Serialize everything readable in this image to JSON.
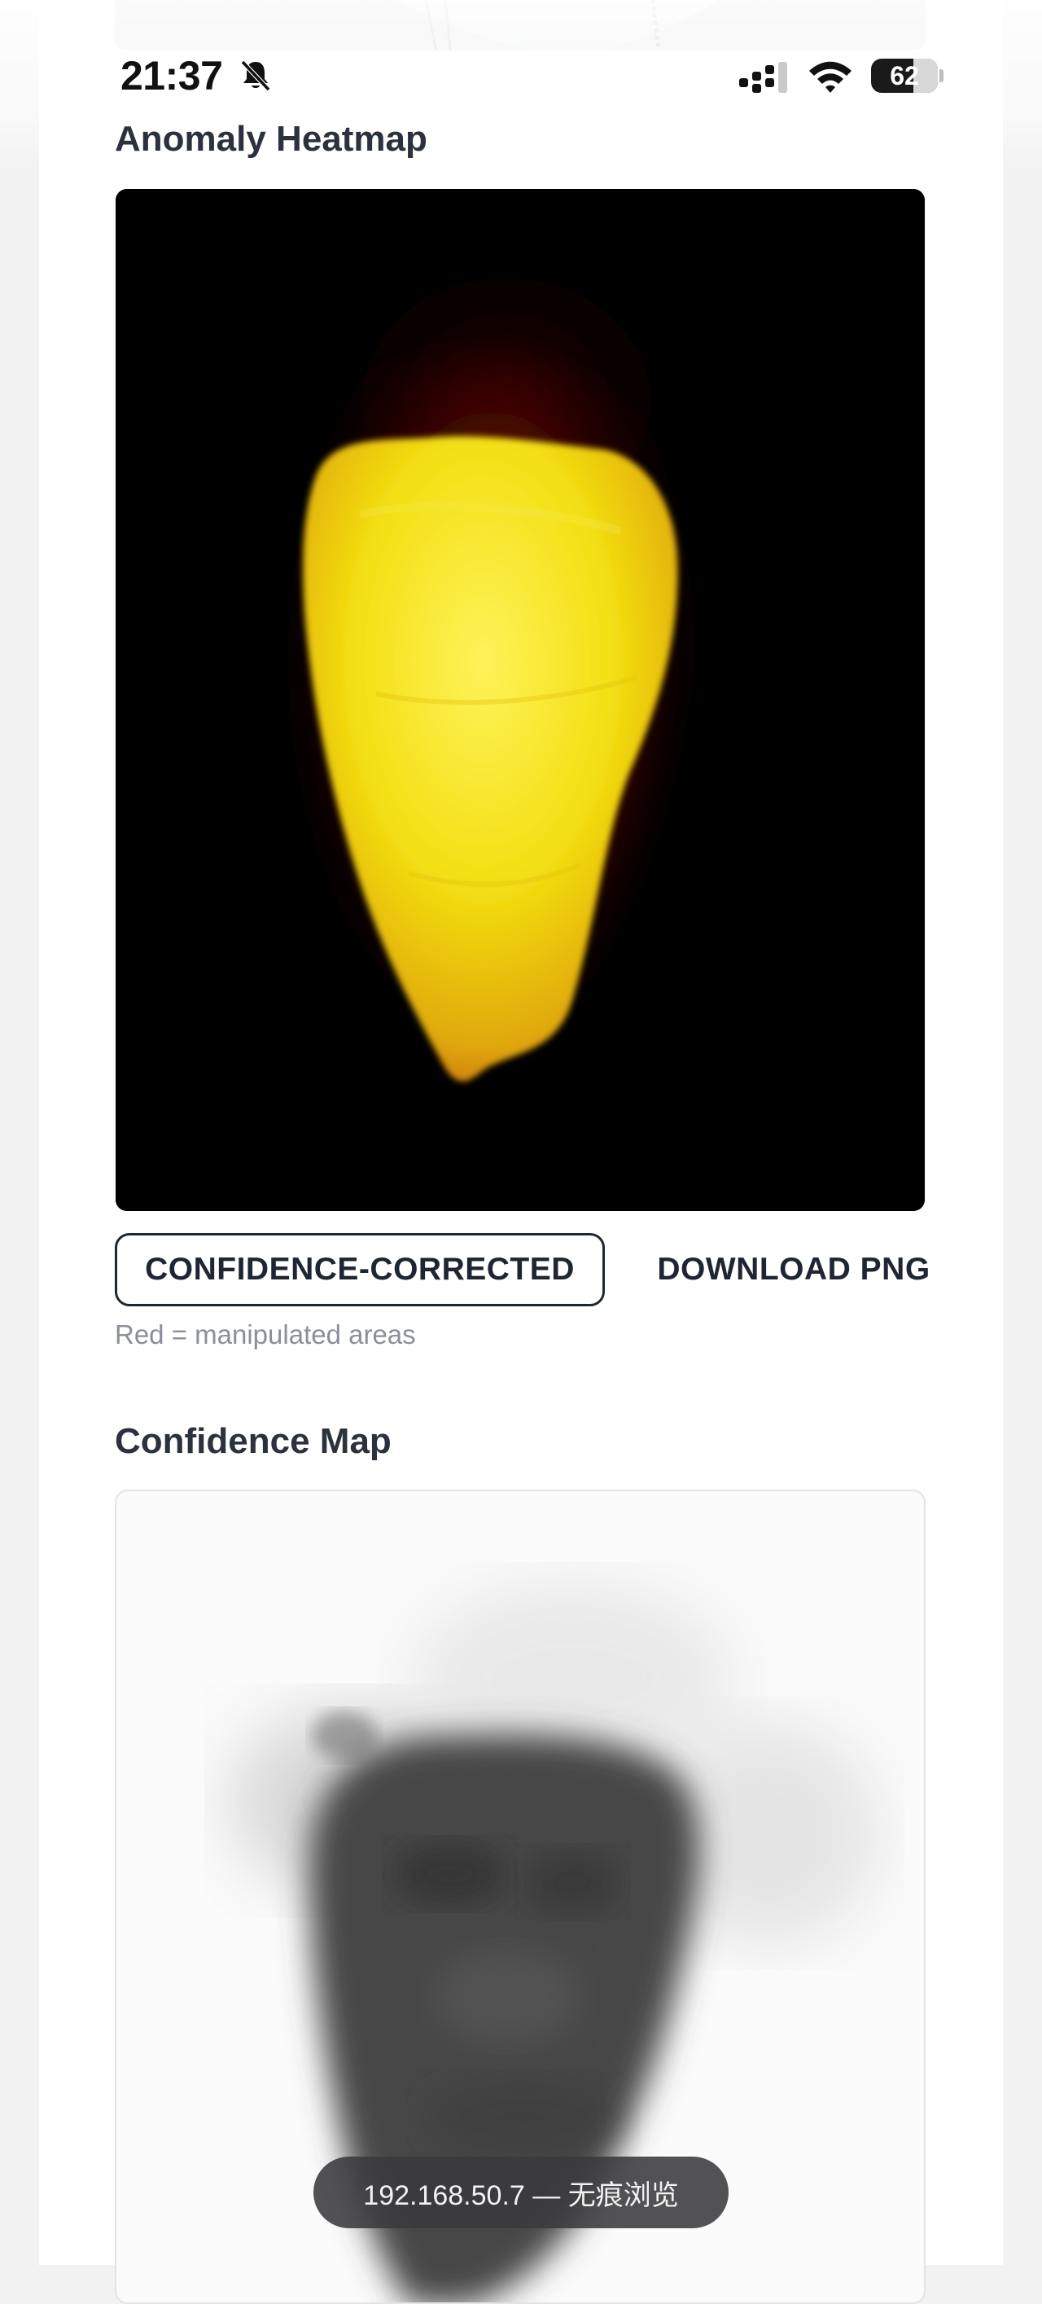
{
  "status_bar": {
    "time": "21:37",
    "battery": "62",
    "icons": [
      "bell-muted-icon",
      "signal-icon",
      "wifi-icon",
      "battery-icon"
    ]
  },
  "heatmap_section": {
    "title": "Anomaly Heatmap",
    "mode_button_label": "CONFIDENCE-CORRECTED",
    "download_button_label": "DOWNLOAD PNG",
    "caption": "Red = manipulated areas"
  },
  "confidence_section": {
    "title": "Confidence Map"
  },
  "browser": {
    "address_pill": "192.168.50.7 — 无痕浏览"
  },
  "colors": {
    "heat_hot": "#f5e20a",
    "heat_warm": "#d86b0c",
    "heat_edge": "#7a0f05",
    "background": "#000000",
    "text_dark": "#1f2633",
    "caption_gray": "#8a8f98"
  }
}
